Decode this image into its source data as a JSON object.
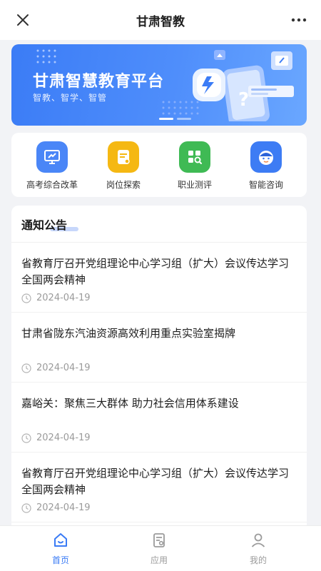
{
  "header": {
    "title": "甘肃智教",
    "close_icon": "close-icon",
    "more_icon": "more-icon"
  },
  "banner": {
    "title": "甘肃智慧教育平台",
    "subtitle": "智教、智学、智管"
  },
  "quick_links": [
    {
      "label": "高考综合改革",
      "icon": "presentation-icon",
      "color": "#4a86f7"
    },
    {
      "label": "岗位探索",
      "icon": "document-icon",
      "color": "#f5b813"
    },
    {
      "label": "职业测评",
      "icon": "grid-search-icon",
      "color": "#3fba54"
    },
    {
      "label": "智能咨询",
      "icon": "advisor-icon",
      "color": "#3d7cf4"
    }
  ],
  "notices": {
    "title": "通知公告",
    "items": [
      {
        "title": "省教育厅召开党组理论中心学习组（扩大）会议传达学习全国两会精神",
        "date": "2024-04-19"
      },
      {
        "title": "甘肃省陇东汽油资源高效利用重点实验室揭牌",
        "date": "2024-04-19"
      },
      {
        "title": "嘉峪关：聚焦三大群体 助力社会信用体系建设",
        "date": "2024-04-19"
      },
      {
        "title": "省教育厅召开党组理论中心学习组（扩大）会议传达学习全国两会精神",
        "date": "2024-04-19"
      }
    ]
  },
  "tabbar": {
    "tabs": [
      {
        "label": "首页",
        "icon": "home-icon",
        "active": true
      },
      {
        "label": "应用",
        "icon": "apps-icon",
        "active": false
      },
      {
        "label": "我的",
        "icon": "profile-icon",
        "active": false
      }
    ]
  },
  "colors": {
    "accent": "#3a7bf5",
    "banner": "#4f8efb"
  }
}
